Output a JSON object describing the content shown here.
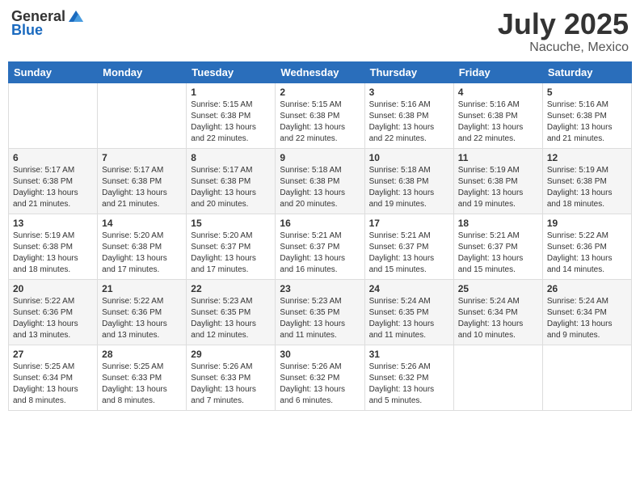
{
  "header": {
    "logo_general": "General",
    "logo_blue": "Blue",
    "title": "July 2025",
    "subtitle": "Nacuche, Mexico"
  },
  "weekdays": [
    "Sunday",
    "Monday",
    "Tuesday",
    "Wednesday",
    "Thursday",
    "Friday",
    "Saturday"
  ],
  "weeks": [
    [
      {
        "day": "",
        "info": ""
      },
      {
        "day": "",
        "info": ""
      },
      {
        "day": "1",
        "info": "Sunrise: 5:15 AM\nSunset: 6:38 PM\nDaylight: 13 hours and 22 minutes."
      },
      {
        "day": "2",
        "info": "Sunrise: 5:15 AM\nSunset: 6:38 PM\nDaylight: 13 hours and 22 minutes."
      },
      {
        "day": "3",
        "info": "Sunrise: 5:16 AM\nSunset: 6:38 PM\nDaylight: 13 hours and 22 minutes."
      },
      {
        "day": "4",
        "info": "Sunrise: 5:16 AM\nSunset: 6:38 PM\nDaylight: 13 hours and 22 minutes."
      },
      {
        "day": "5",
        "info": "Sunrise: 5:16 AM\nSunset: 6:38 PM\nDaylight: 13 hours and 21 minutes."
      }
    ],
    [
      {
        "day": "6",
        "info": "Sunrise: 5:17 AM\nSunset: 6:38 PM\nDaylight: 13 hours and 21 minutes."
      },
      {
        "day": "7",
        "info": "Sunrise: 5:17 AM\nSunset: 6:38 PM\nDaylight: 13 hours and 21 minutes."
      },
      {
        "day": "8",
        "info": "Sunrise: 5:17 AM\nSunset: 6:38 PM\nDaylight: 13 hours and 20 minutes."
      },
      {
        "day": "9",
        "info": "Sunrise: 5:18 AM\nSunset: 6:38 PM\nDaylight: 13 hours and 20 minutes."
      },
      {
        "day": "10",
        "info": "Sunrise: 5:18 AM\nSunset: 6:38 PM\nDaylight: 13 hours and 19 minutes."
      },
      {
        "day": "11",
        "info": "Sunrise: 5:19 AM\nSunset: 6:38 PM\nDaylight: 13 hours and 19 minutes."
      },
      {
        "day": "12",
        "info": "Sunrise: 5:19 AM\nSunset: 6:38 PM\nDaylight: 13 hours and 18 minutes."
      }
    ],
    [
      {
        "day": "13",
        "info": "Sunrise: 5:19 AM\nSunset: 6:38 PM\nDaylight: 13 hours and 18 minutes."
      },
      {
        "day": "14",
        "info": "Sunrise: 5:20 AM\nSunset: 6:38 PM\nDaylight: 13 hours and 17 minutes."
      },
      {
        "day": "15",
        "info": "Sunrise: 5:20 AM\nSunset: 6:37 PM\nDaylight: 13 hours and 17 minutes."
      },
      {
        "day": "16",
        "info": "Sunrise: 5:21 AM\nSunset: 6:37 PM\nDaylight: 13 hours and 16 minutes."
      },
      {
        "day": "17",
        "info": "Sunrise: 5:21 AM\nSunset: 6:37 PM\nDaylight: 13 hours and 15 minutes."
      },
      {
        "day": "18",
        "info": "Sunrise: 5:21 AM\nSunset: 6:37 PM\nDaylight: 13 hours and 15 minutes."
      },
      {
        "day": "19",
        "info": "Sunrise: 5:22 AM\nSunset: 6:36 PM\nDaylight: 13 hours and 14 minutes."
      }
    ],
    [
      {
        "day": "20",
        "info": "Sunrise: 5:22 AM\nSunset: 6:36 PM\nDaylight: 13 hours and 13 minutes."
      },
      {
        "day": "21",
        "info": "Sunrise: 5:22 AM\nSunset: 6:36 PM\nDaylight: 13 hours and 13 minutes."
      },
      {
        "day": "22",
        "info": "Sunrise: 5:23 AM\nSunset: 6:35 PM\nDaylight: 13 hours and 12 minutes."
      },
      {
        "day": "23",
        "info": "Sunrise: 5:23 AM\nSunset: 6:35 PM\nDaylight: 13 hours and 11 minutes."
      },
      {
        "day": "24",
        "info": "Sunrise: 5:24 AM\nSunset: 6:35 PM\nDaylight: 13 hours and 11 minutes."
      },
      {
        "day": "25",
        "info": "Sunrise: 5:24 AM\nSunset: 6:34 PM\nDaylight: 13 hours and 10 minutes."
      },
      {
        "day": "26",
        "info": "Sunrise: 5:24 AM\nSunset: 6:34 PM\nDaylight: 13 hours and 9 minutes."
      }
    ],
    [
      {
        "day": "27",
        "info": "Sunrise: 5:25 AM\nSunset: 6:34 PM\nDaylight: 13 hours and 8 minutes."
      },
      {
        "day": "28",
        "info": "Sunrise: 5:25 AM\nSunset: 6:33 PM\nDaylight: 13 hours and 8 minutes."
      },
      {
        "day": "29",
        "info": "Sunrise: 5:26 AM\nSunset: 6:33 PM\nDaylight: 13 hours and 7 minutes."
      },
      {
        "day": "30",
        "info": "Sunrise: 5:26 AM\nSunset: 6:32 PM\nDaylight: 13 hours and 6 minutes."
      },
      {
        "day": "31",
        "info": "Sunrise: 5:26 AM\nSunset: 6:32 PM\nDaylight: 13 hours and 5 minutes."
      },
      {
        "day": "",
        "info": ""
      },
      {
        "day": "",
        "info": ""
      }
    ]
  ]
}
